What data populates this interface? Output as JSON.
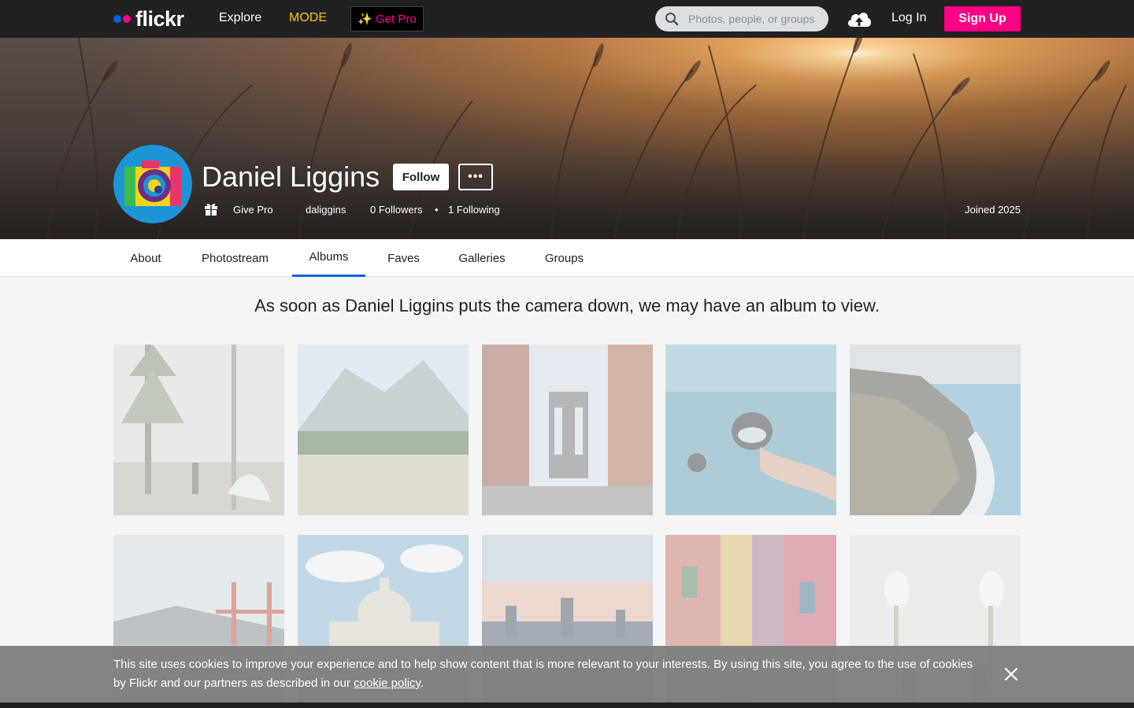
{
  "nav": {
    "logo": "flickr",
    "explore": "Explore",
    "mode": "MODE",
    "get_pro": "Get Pro",
    "search_placeholder": "Photos, people, or groups",
    "login": "Log In",
    "signup": "Sign Up"
  },
  "profile": {
    "name": "Daniel Liggins",
    "follow": "Follow",
    "more": "•••",
    "give_pro": "Give Pro",
    "username": "daliggins",
    "followers": "0 Followers",
    "bullet": "•",
    "following": "1 Following",
    "joined": "Joined 2025"
  },
  "tabs": [
    "About",
    "Photostream",
    "Albums",
    "Faves",
    "Galleries",
    "Groups"
  ],
  "active_tab": "Albums",
  "empty_message": "As soon as Daniel Liggins puts the camera down, we may have an album to view.",
  "cookie": {
    "text": "This site uses cookies to improve your experience and to help show content that is more relevant to your interests. By using this site, you agree to the use of cookies by Flickr and our partners as described in our ",
    "link": "cookie policy",
    "end": "."
  },
  "colors": {
    "brand_blue": "#0063dc",
    "brand_pink": "#ff0084",
    "nav_bg": "#212124",
    "mode": "#f5c518"
  }
}
